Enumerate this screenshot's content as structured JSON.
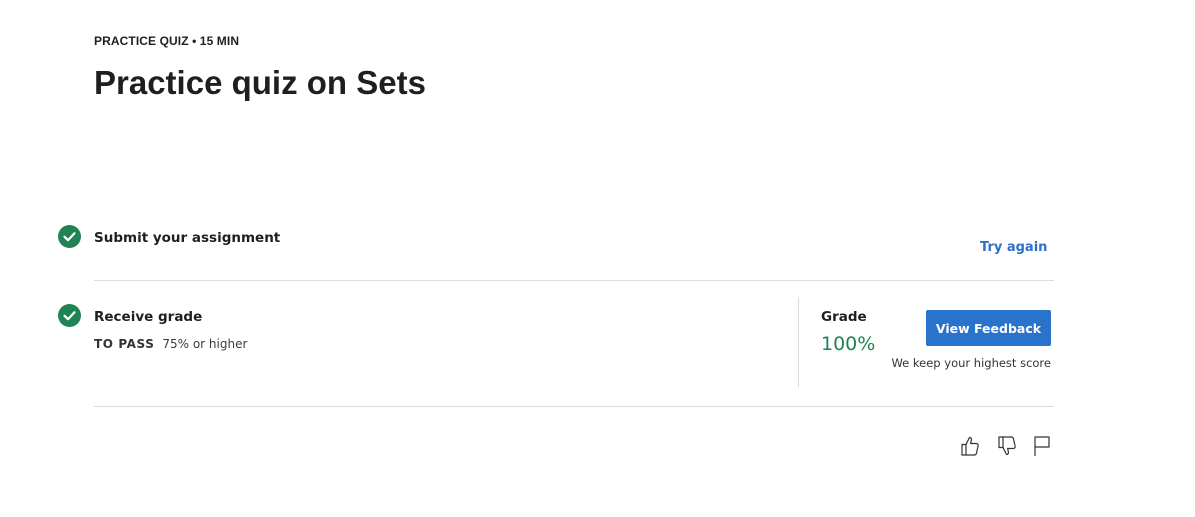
{
  "header": {
    "eyebrow": "PRACTICE QUIZ • 15 MIN",
    "title": "Practice quiz on Sets"
  },
  "steps": [
    {
      "title": "Submit your assignment",
      "status": "complete",
      "action_label": "Try again"
    },
    {
      "title": "Receive grade",
      "status": "complete",
      "pass_label": "TO PASS",
      "pass_value": "75% or higher",
      "grade_label": "Grade",
      "grade_value": "100%",
      "button_label": "View Feedback",
      "note": "We keep your highest score"
    }
  ],
  "feedback_icons": [
    "thumbs-up-icon",
    "thumbs-down-icon",
    "flag-icon"
  ],
  "colors": {
    "success": "#1f8354",
    "primary": "#2a73cc",
    "link": "#2f6fc9",
    "text": "#1f1f1f"
  }
}
